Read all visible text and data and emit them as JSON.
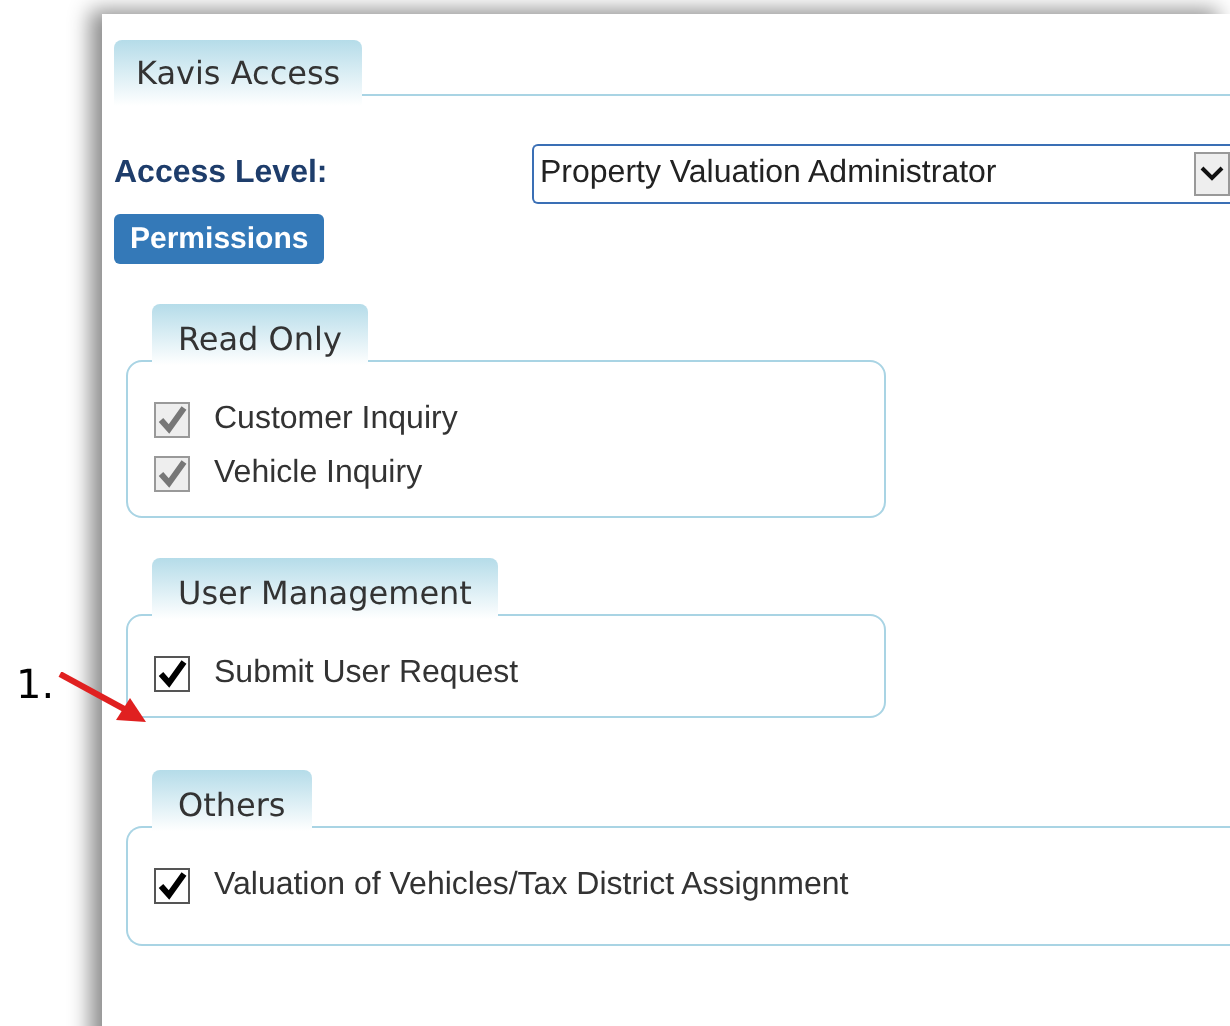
{
  "tab": {
    "label": "Kavis Access",
    "selected": true
  },
  "access_level": {
    "label": "Access Level:",
    "value": "Property Valuation Administrator"
  },
  "section_button": "Permissions",
  "groups": [
    {
      "title": "Read Only",
      "items": [
        {
          "label": "Customer Inquiry",
          "checked": true,
          "disabled": true
        },
        {
          "label": "Vehicle Inquiry",
          "checked": true,
          "disabled": true
        }
      ]
    },
    {
      "title": "User Management",
      "items": [
        {
          "label": "Submit User Request",
          "checked": true,
          "disabled": false
        }
      ]
    },
    {
      "title": "Others",
      "items": [
        {
          "label": "Valuation of Vehicles/Tax District Assignment",
          "checked": true,
          "disabled": false
        }
      ]
    }
  ],
  "annotation": {
    "label": "1."
  }
}
